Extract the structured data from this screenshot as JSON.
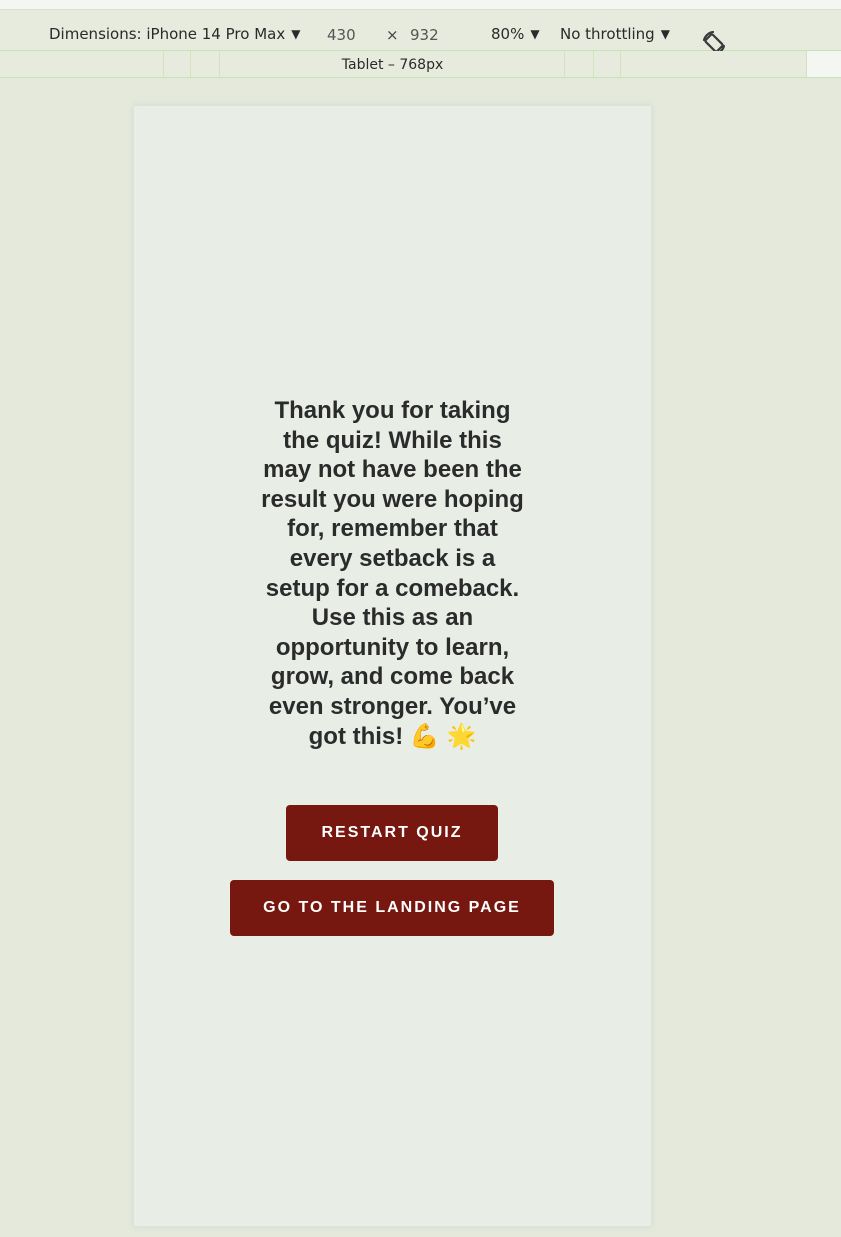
{
  "devtools": {
    "dimensions_label": "Dimensions: iPhone 14 Pro Max",
    "width": "430",
    "times": "×",
    "height": "932",
    "zoom": "80%",
    "throttling": "No throttling",
    "rotate_icon": "rotate-icon",
    "breakpoint_label": "Tablet – 768px"
  },
  "page": {
    "message": "Thank you for taking the quiz! While this may not have been the result you were hoping for, remember that every setback is a setup for a comeback. Use this as an opportunity to learn, grow, and come back even stronger. You’ve got this! 💪 🌟",
    "restart_label": "RESTART QUIZ",
    "landing_label": "GO TO THE LANDING PAGE"
  },
  "colors": {
    "button": "#761710",
    "button_text": "#ffffff",
    "page_bg": "#e8eee6",
    "outer_bg": "#e4e9dc"
  }
}
